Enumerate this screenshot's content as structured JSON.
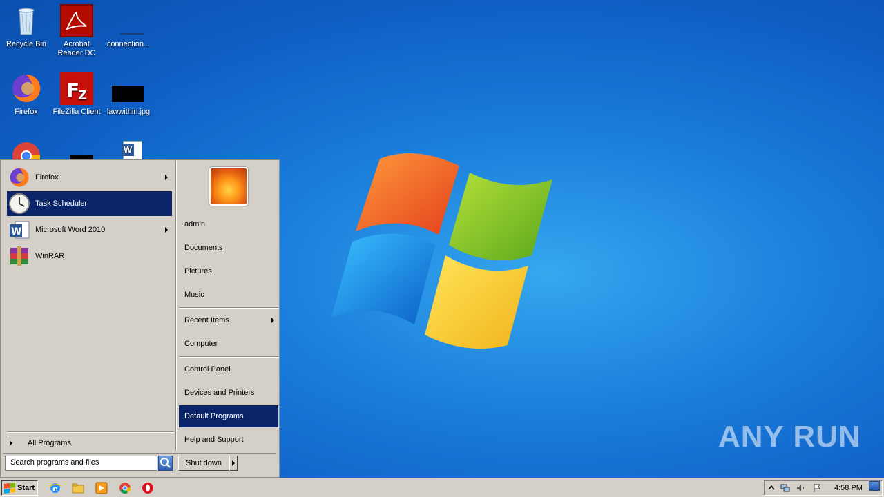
{
  "desktop": {
    "icons": [
      {
        "label": "Recycle Bin",
        "icon": "recycle-bin-icon"
      },
      {
        "label": "Acrobat Reader DC",
        "icon": "acrobat-icon"
      },
      {
        "label": "connection...",
        "icon": "file-icon"
      },
      {
        "label": "Firefox",
        "icon": "firefox-icon"
      },
      {
        "label": "FileZilla Client",
        "icon": "filezilla-icon"
      },
      {
        "label": "lawwithin.jpg",
        "icon": "image-file-icon"
      },
      {
        "label": "",
        "icon": "chrome-icon"
      },
      {
        "label": "",
        "icon": "black-file-icon"
      },
      {
        "label": "",
        "icon": "word-document-icon"
      }
    ],
    "watermark": "ANY RUN"
  },
  "start_menu": {
    "pinned": [
      {
        "label": "Firefox",
        "icon": "firefox-icon",
        "has_submenu": true
      },
      {
        "label": "Task Scheduler",
        "icon": "clock-icon",
        "has_submenu": false,
        "selected": true
      },
      {
        "label": "Microsoft Word 2010",
        "icon": "word-icon",
        "has_submenu": true
      },
      {
        "label": "WinRAR",
        "icon": "winrar-icon",
        "has_submenu": false
      }
    ],
    "all_programs": "All Programs",
    "search_placeholder": "Search programs and files",
    "shutdown_label": "Shut down",
    "right": [
      {
        "label": "admin"
      },
      {
        "label": "Documents"
      },
      {
        "label": "Pictures"
      },
      {
        "label": "Music"
      },
      {
        "label": "Recent Items",
        "has_submenu": true
      },
      {
        "label": "Computer"
      },
      {
        "label": "Control Panel"
      },
      {
        "label": "Devices and Printers"
      },
      {
        "label": "Default Programs",
        "selected": true
      },
      {
        "label": "Help and Support"
      }
    ]
  },
  "taskbar": {
    "start_label": "Start",
    "quick_launch": [
      "ie-icon",
      "explorer-icon",
      "media-player-icon",
      "chrome-icon",
      "opera-icon"
    ],
    "tray_icons": [
      "show-hidden-icons-icon",
      "network-icon",
      "volume-icon",
      "action-center-flag-icon"
    ],
    "clock": "4:58 PM"
  },
  "colors": {
    "selection": "#0a246a",
    "menu_bg": "#d4d0c8",
    "desktop_blue": "#1b7fdc"
  }
}
